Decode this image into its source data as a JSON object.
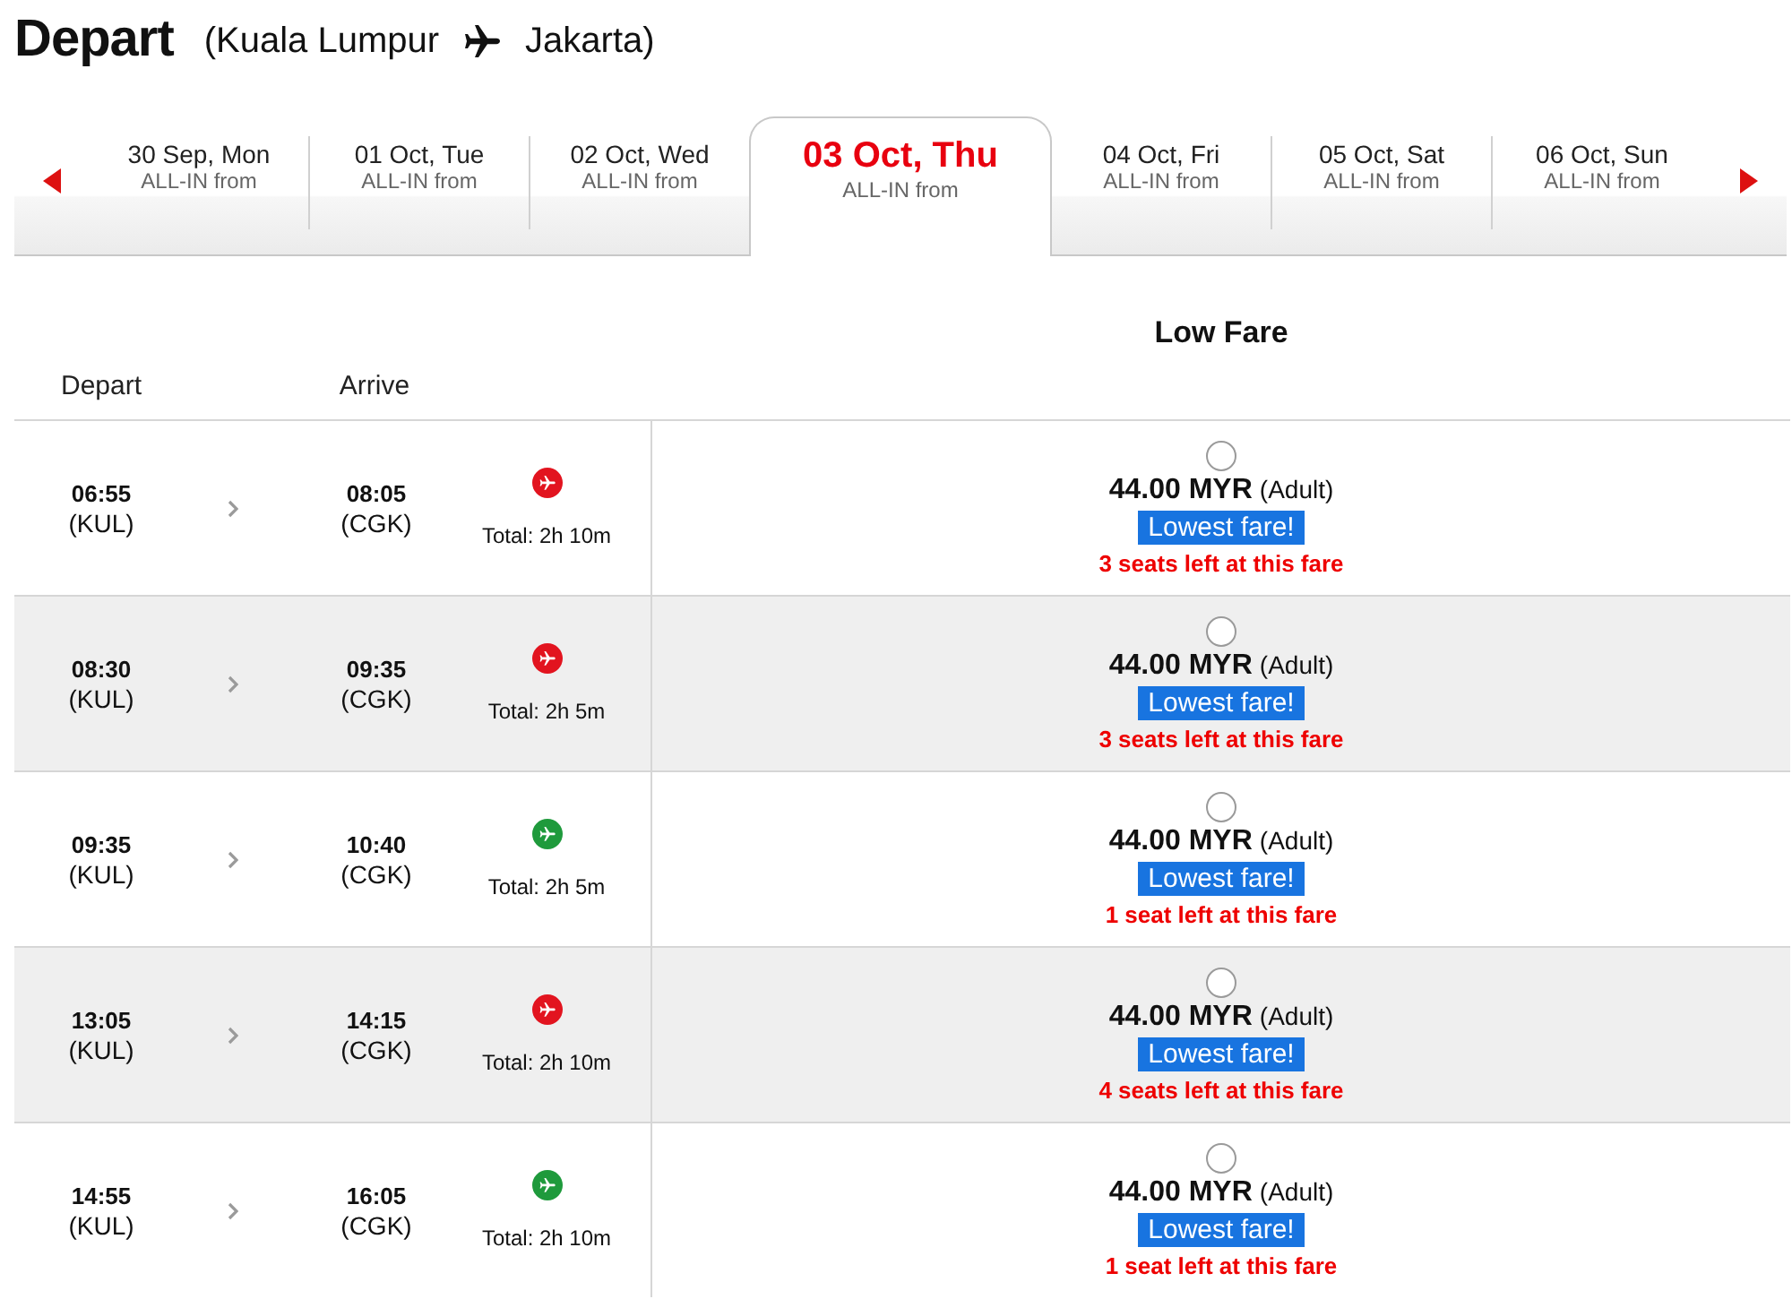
{
  "header": {
    "title": "Depart",
    "origin": "(Kuala Lumpur",
    "destination": "Jakarta)"
  },
  "dates": [
    {
      "date": "30 Sep, Mon",
      "label": "ALL-IN from",
      "selected": false
    },
    {
      "date": "01 Oct, Tue",
      "label": "ALL-IN from",
      "selected": false
    },
    {
      "date": "02 Oct, Wed",
      "label": "ALL-IN from",
      "selected": false
    },
    {
      "date": "03 Oct, Thu",
      "label": "ALL-IN from",
      "selected": true
    },
    {
      "date": "04 Oct, Fri",
      "label": "ALL-IN from",
      "selected": false
    },
    {
      "date": "05 Oct, Sat",
      "label": "ALL-IN from",
      "selected": false
    },
    {
      "date": "06 Oct, Sun",
      "label": "ALL-IN from",
      "selected": false
    }
  ],
  "table": {
    "columns": {
      "depart": "Depart",
      "arrive": "Arrive",
      "fare": "Low Fare"
    },
    "rows": [
      {
        "depart": {
          "time": "06:55",
          "airport": "(KUL)"
        },
        "arrive": {
          "time": "08:05",
          "airport": "(CGK)"
        },
        "color": "#e2141f",
        "duration": "Total: 2h 10m",
        "fare": {
          "selected": false,
          "price": "44.00 MYR",
          "passenger": "(Adult)",
          "badge": "Lowest fare!",
          "seats": "3 seats left at this fare"
        }
      },
      {
        "depart": {
          "time": "08:30",
          "airport": "(KUL)"
        },
        "arrive": {
          "time": "09:35",
          "airport": "(CGK)"
        },
        "color": "#e2141f",
        "duration": "Total: 2h 5m",
        "fare": {
          "selected": false,
          "price": "44.00 MYR",
          "passenger": "(Adult)",
          "badge": "Lowest fare!",
          "seats": "3 seats left at this fare"
        }
      },
      {
        "depart": {
          "time": "09:35",
          "airport": "(KUL)"
        },
        "arrive": {
          "time": "10:40",
          "airport": "(CGK)"
        },
        "color": "#1f9a3c",
        "duration": "Total: 2h 5m",
        "fare": {
          "selected": false,
          "price": "44.00 MYR",
          "passenger": "(Adult)",
          "badge": "Lowest fare!",
          "seats": "1 seat left at this fare"
        }
      },
      {
        "depart": {
          "time": "13:05",
          "airport": "(KUL)"
        },
        "arrive": {
          "time": "14:15",
          "airport": "(CGK)"
        },
        "color": "#e2141f",
        "duration": "Total: 2h 10m",
        "fare": {
          "selected": false,
          "price": "44.00 MYR",
          "passenger": "(Adult)",
          "badge": "Lowest fare!",
          "seats": "4 seats left at this fare"
        }
      },
      {
        "depart": {
          "time": "14:55",
          "airport": "(KUL)"
        },
        "arrive": {
          "time": "16:05",
          "airport": "(CGK)"
        },
        "color": "#1f9a3c",
        "duration": "Total: 2h 10m",
        "fare": {
          "selected": false,
          "price": "44.00 MYR",
          "passenger": "(Adult)",
          "badge": "Lowest fare!",
          "seats": "1 seat left at this fare"
        }
      }
    ]
  }
}
